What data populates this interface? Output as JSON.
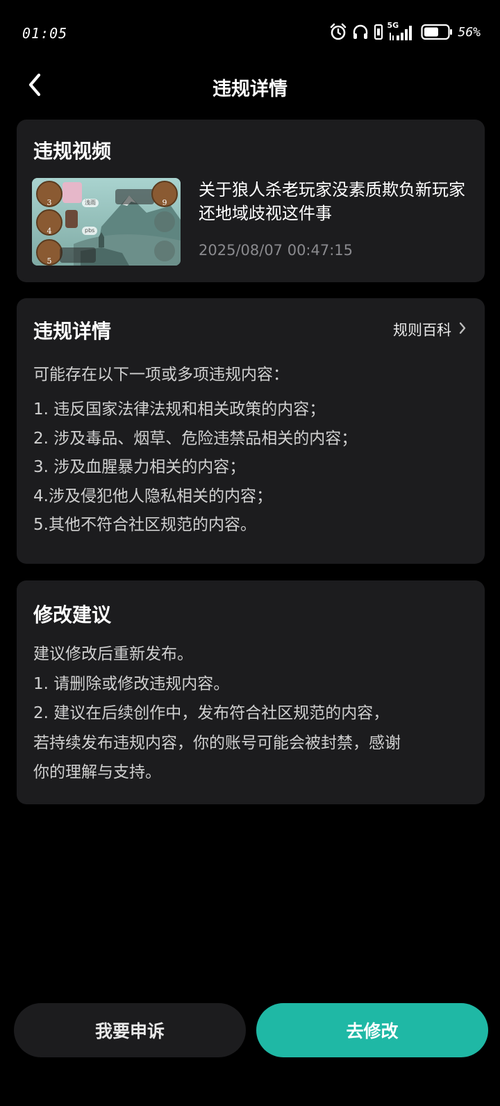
{
  "status_bar": {
    "time": "01:05",
    "network": "5G",
    "battery_percent": "56%",
    "icons": [
      "alarm-icon",
      "headphones-icon",
      "vibrate-icon",
      "signal-icon",
      "battery-icon"
    ]
  },
  "nav": {
    "title": "违规详情",
    "back_icon": "chevron-left-icon"
  },
  "video_card": {
    "title": "违规视频",
    "video_title": "关于狼人杀老玩家没素质欺负新玩家还地域歧视这件事",
    "video_time": "2025/08/07 00:47:15",
    "thumbnail": {
      "seat_numbers_left": [
        "3",
        "4",
        "5"
      ],
      "seat_number_right": "9",
      "player_tags": [
        "浅雨",
        "pbs"
      ]
    }
  },
  "detail_card": {
    "title": "违规详情",
    "rules_link": "规则百科",
    "intro": "可能存在以下一项或多项违规内容：",
    "items": [
      "1. 违反国家法律法规和相关政策的内容；",
      "2. 涉及毒品、烟草、危险违禁品相关的内容；",
      "3. 涉及血腥暴力相关的内容；",
      "4.涉及侵犯他人隐私相关的内容；",
      "5.其他不符合社区规范的内容。"
    ]
  },
  "suggest_card": {
    "title": "修改建议",
    "lines": [
      "建议修改后重新发布。",
      "1. 请删除或修改违规内容。",
      "2. 建议在后续创作中，发布符合社区规范的内容，",
      "若持续发布违规内容，你的账号可能会被封禁，感谢",
      "你的理解与支持。"
    ]
  },
  "buttons": {
    "appeal": "我要申诉",
    "modify": "去修改"
  },
  "colors": {
    "background": "#000000",
    "card": "#1c1c1e",
    "accent": "#1fb8a5",
    "secondary_text": "#8a8a8e"
  }
}
